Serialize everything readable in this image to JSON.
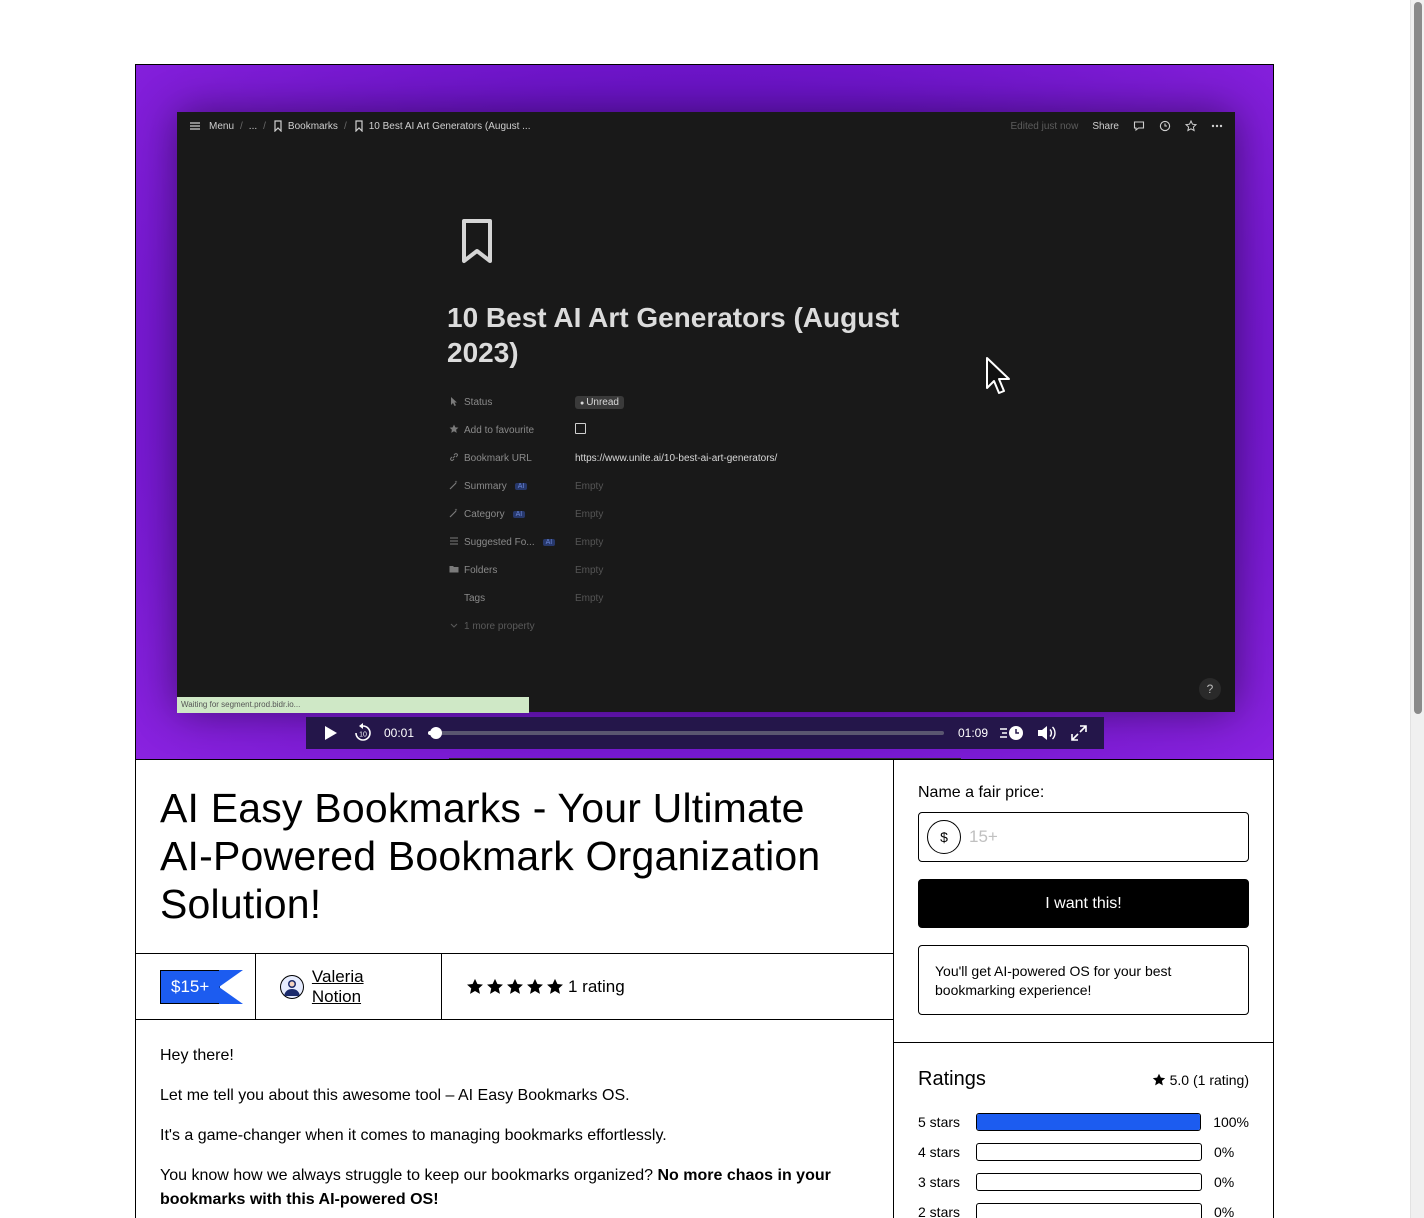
{
  "video": {
    "topbar": {
      "menu": "Menu",
      "ellipsis": "...",
      "crumb_bookmarks": "Bookmarks",
      "crumb_page": "10 Best AI Art Generators (August ...",
      "edited": "Edited just now",
      "share": "Share"
    },
    "page_title": "10 Best AI Art Generators (August 2023)",
    "properties": [
      {
        "label": "Status",
        "icon": "cursor-icon",
        "ai": false,
        "value": "Unread",
        "kind": "pill"
      },
      {
        "label": "Add to favourite",
        "icon": "star-icon",
        "ai": false,
        "value": "",
        "kind": "checkbox"
      },
      {
        "label": "Bookmark URL",
        "icon": "link-icon",
        "ai": false,
        "value": "https://www.unite.ai/10-best-ai-art-generators/",
        "kind": "url"
      },
      {
        "label": "Summary",
        "icon": "magic-icon",
        "ai": true,
        "value": "Empty",
        "kind": "empty"
      },
      {
        "label": "Category",
        "icon": "magic-icon",
        "ai": true,
        "value": "Empty",
        "kind": "empty"
      },
      {
        "label": "Suggested Fo...",
        "icon": "list-icon",
        "ai": true,
        "value": "Empty",
        "kind": "empty"
      },
      {
        "label": "Folders",
        "icon": "folder-icon",
        "ai": false,
        "value": "Empty",
        "kind": "empty"
      },
      {
        "label": "Tags",
        "icon": "",
        "ai": false,
        "value": "Empty",
        "kind": "empty"
      },
      {
        "label": "1 more property",
        "icon": "chevron-down-icon",
        "ai": false,
        "value": "",
        "kind": "more"
      }
    ],
    "ai_badge": "AI",
    "help": "?",
    "status_bar": "Waiting for segment.prod.bidr.io...",
    "player": {
      "current_time": "00:01",
      "duration": "01:09",
      "progress": 0.015
    }
  },
  "product": {
    "title": "AI Easy Bookmarks - Your Ultimate AI-Powered Bookmark Organization Solution!",
    "price_badge": "$15+",
    "creator": "Valeria Notion",
    "rating_stars": 5,
    "rating_count": "1 rating",
    "description": {
      "p1": "Hey there!",
      "p2": "Let me tell you about this awesome tool – AI Easy Bookmarks OS.",
      "p3": "It's a game-changer when it comes to managing bookmarks effortlessly.",
      "p4_plain": "You know how we always struggle to keep our bookmarks organized? ",
      "p4_bold": "No more chaos in your bookmarks with this AI-powered OS!"
    }
  },
  "purchase": {
    "label": "Name a fair price:",
    "currency_symbol": "$",
    "price_placeholder": "15+",
    "buy_label": "I want this!",
    "summary": "You'll get AI-powered OS for your best bookmarking experience!"
  },
  "ratings": {
    "heading": "Ratings",
    "average": "5.0 (1 rating)",
    "rows": [
      {
        "label": "5 stars",
        "percent": 100,
        "percent_label": "100%"
      },
      {
        "label": "4 stars",
        "percent": 0,
        "percent_label": "0%"
      },
      {
        "label": "3 stars",
        "percent": 0,
        "percent_label": "0%"
      },
      {
        "label": "2 stars",
        "percent": 0,
        "percent_label": "0%"
      }
    ]
  },
  "colors": {
    "accent": "#1c5cf0",
    "hero_purple": "#6c14c8",
    "player_bg": "#24164a"
  }
}
